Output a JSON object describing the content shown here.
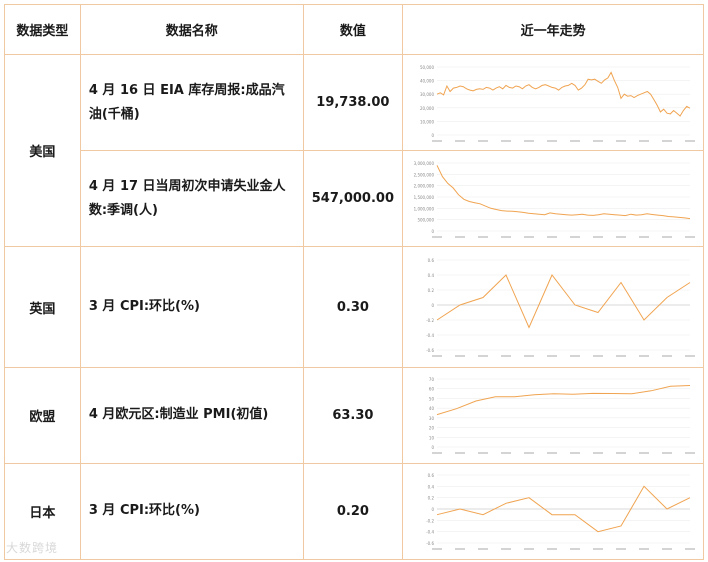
{
  "header": {
    "type": "数据类型",
    "name": "数据名称",
    "value": "数值",
    "trend": "近一年走势"
  },
  "rows": [
    {
      "type": "美国",
      "name": "4 月 16 日 EIA 库存周报:成品汽油(千桶)",
      "value": "19,738.00"
    },
    {
      "type": "",
      "name": "4 月 17 日当周初次申请失业金人数:季调(人)",
      "value": "547,000.00"
    },
    {
      "type": "英国",
      "name": "3 月 CPI:环比(%)",
      "value": "0.30"
    },
    {
      "type": "欧盟",
      "name": "4 月欧元区:制造业 PMI(初值)",
      "value": "63.30"
    },
    {
      "type": "日本",
      "name": "3 月 CPI:环比(%)",
      "value": "0.20"
    }
  ],
  "watermark": "大数跨境",
  "colors": {
    "border": "#f0c9a2",
    "line": "#f0a451"
  },
  "chart_data": [
    {
      "type": "line",
      "name": "EIA gasoline",
      "ylim": [
        0,
        50000
      ],
      "ticks": [
        "50,000",
        "40,000",
        "30,000",
        "20,000",
        "10,000",
        "0"
      ],
      "values": [
        30000,
        31000,
        29500,
        36000,
        32000,
        34500,
        35000,
        36000,
        35500,
        34000,
        33000,
        32500,
        33500,
        34000,
        33500,
        35000,
        34500,
        33000,
        34500,
        35500,
        34000,
        36500,
        35000,
        34500,
        36000,
        35500,
        34000,
        36000,
        37000,
        35000,
        34000,
        35000,
        36500,
        37000,
        36000,
        35000,
        34500,
        33000,
        35000,
        36000,
        36500,
        38000,
        36500,
        33000,
        34500,
        37000,
        41000,
        40500,
        41000,
        39500,
        38000,
        40500,
        42000,
        46000,
        40000,
        35000,
        27000,
        30000,
        28500,
        29000,
        27500,
        29000,
        30000,
        31000,
        32000,
        30000,
        26000,
        22000,
        17000,
        19000,
        16000,
        15500,
        18000,
        16000,
        14000,
        18000,
        21000,
        19738
      ]
    },
    {
      "type": "line",
      "name": "initial claims",
      "ylim": [
        0,
        3000000
      ],
      "ticks": [
        "3,000,000",
        "2,500,000",
        "2,000,000",
        "1,500,000",
        "1,000,000",
        "500,000",
        "0"
      ],
      "values": [
        2900000,
        2400000,
        2100000,
        1900000,
        1600000,
        1400000,
        1300000,
        1250000,
        1200000,
        1100000,
        1000000,
        950000,
        900000,
        880000,
        870000,
        850000,
        820000,
        780000,
        760000,
        740000,
        720000,
        800000,
        760000,
        740000,
        720000,
        700000,
        720000,
        740000,
        700000,
        690000,
        720000,
        760000,
        740000,
        720000,
        700000,
        680000,
        740000,
        700000,
        720000,
        760000,
        730000,
        700000,
        680000,
        640000,
        620000,
        600000,
        580000,
        547000
      ]
    },
    {
      "type": "line",
      "name": "UK CPI mom",
      "ylim": [
        -0.6,
        0.6
      ],
      "ticks": [
        "0.6",
        "0.4",
        "0.2",
        "0",
        "-0.2",
        "-0.4",
        "-0.6"
      ],
      "values": [
        -0.2,
        0.0,
        0.1,
        0.4,
        -0.3,
        0.4,
        0.0,
        -0.1,
        0.3,
        -0.2,
        0.1,
        0.3
      ]
    },
    {
      "type": "line",
      "name": "EZ PMI",
      "ylim": [
        0,
        70
      ],
      "ticks": [
        "70",
        "60",
        "50",
        "40",
        "30",
        "20",
        "10",
        "0"
      ],
      "values": [
        33.4,
        39.4,
        47.4,
        51.8,
        51.7,
        53.7,
        54.8,
        54.4,
        55.2,
        55.1,
        54.8,
        57.9,
        62.5,
        63.3
      ]
    },
    {
      "type": "line",
      "name": "JP CPI mom",
      "ylim": [
        -0.6,
        0.6
      ],
      "ticks": [
        "0.6",
        "0.4",
        "0.2",
        "0",
        "-0.2",
        "-0.4",
        "-0.6"
      ],
      "values": [
        -0.1,
        0.0,
        -0.1,
        0.1,
        0.2,
        -0.1,
        -0.1,
        -0.4,
        -0.3,
        0.4,
        0.0,
        0.2
      ]
    }
  ]
}
